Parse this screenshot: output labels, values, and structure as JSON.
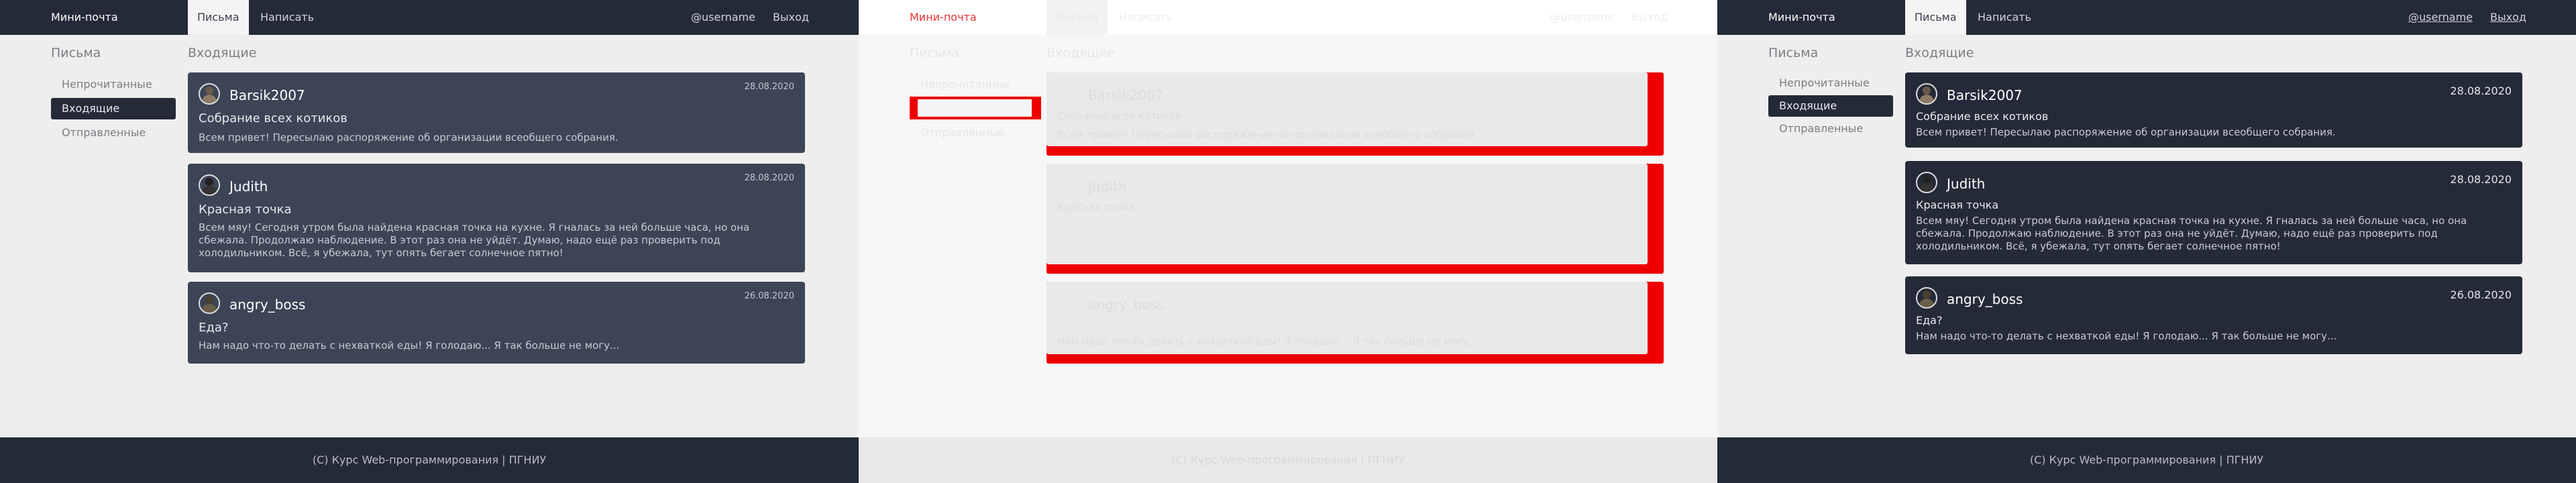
{
  "app": {
    "brand": "Мини-почта",
    "nav_letters": "Письма",
    "nav_compose": "Написать",
    "username": "@username",
    "logout": "Выход"
  },
  "sidebar": {
    "title": "Письма",
    "items": [
      {
        "label": "Непрочитанные"
      },
      {
        "label": "Входящие"
      },
      {
        "label": "Отправленные"
      }
    ]
  },
  "main": {
    "title": "Входящие"
  },
  "messages": [
    {
      "sender": "Barsik2007",
      "date": "28.08.2020",
      "subject": "Собрание всех котиков",
      "preview": "Всем привет! Пересылаю распоряжение об организации всеобщего собрания."
    },
    {
      "sender": "Judith",
      "date": "28.08.2020",
      "subject": "Красная точка",
      "preview": "Всем мяу! Сегодня утром была найдена красная точка на кухне. Я гналась за ней больше часа, но она сбежала. Продолжаю наблюдение. В этот раз она не уйдёт. Думаю, надо ещё раз проверить под холодильником. Всё, я убежала, тут опять бегает солнечное пятно!"
    },
    {
      "sender": "angry_boss",
      "date": "26.08.2020",
      "subject": "Еда?",
      "preview": "Нам надо что-то делать с нехваткой еды! Я голодаю... Я так больше не могу..."
    }
  ],
  "footer": {
    "text": "(С) Курс Web-программирования | ПГНИУ"
  },
  "colors": {
    "navbar": "#252a38",
    "card_left": "#3c4556",
    "card_right": "#252a38",
    "diff_highlight": "#ee0000",
    "page_bg": "#eeeeee"
  }
}
